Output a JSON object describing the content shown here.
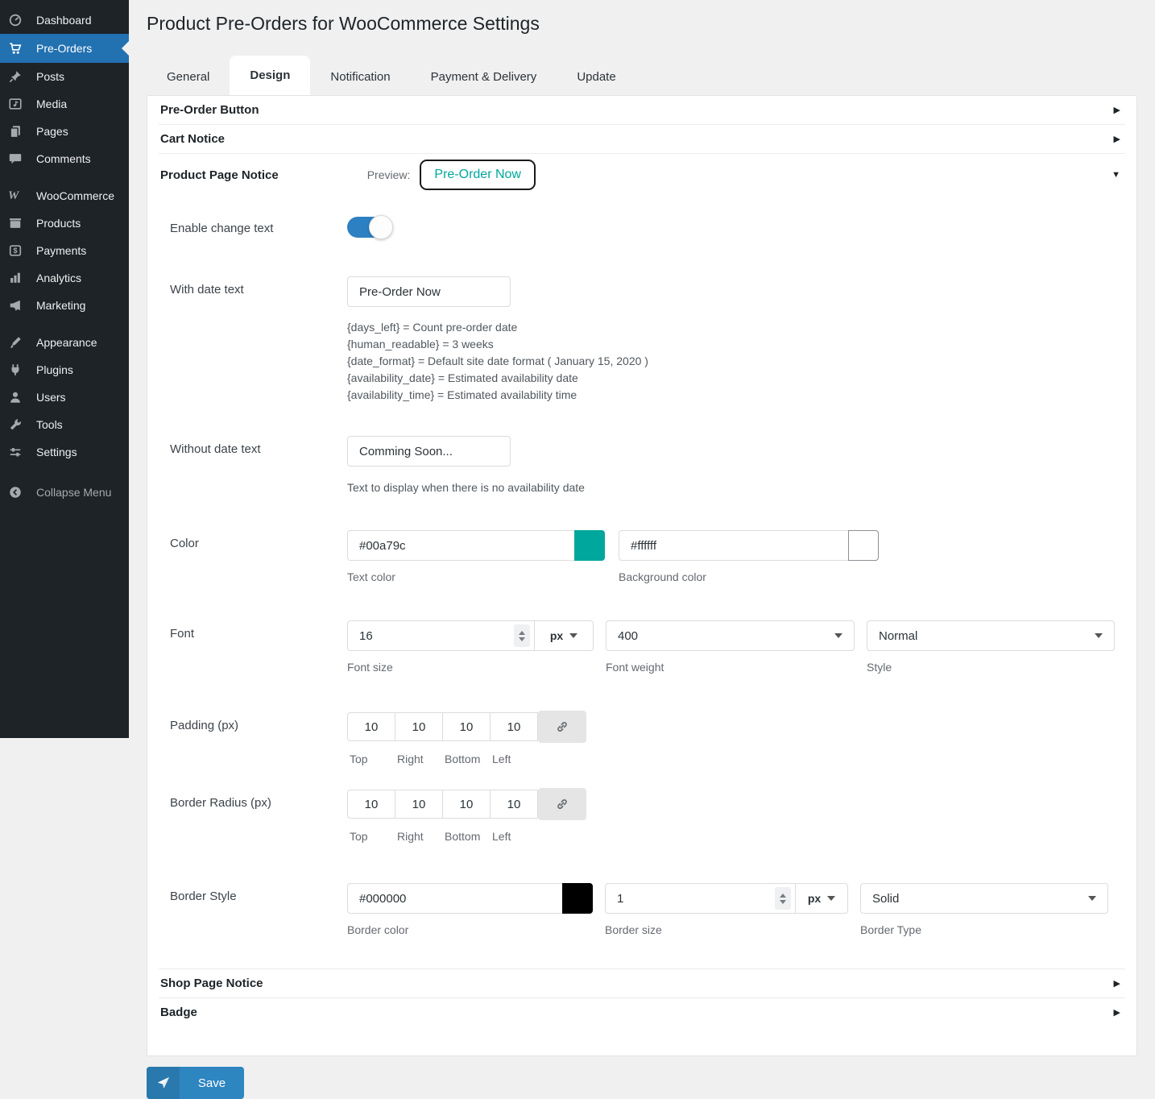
{
  "header": {
    "title": "Product Pre-Orders for WooCommerce Settings"
  },
  "sidebar": {
    "items": [
      {
        "label": "Dashboard",
        "icon": "dashboard-icon"
      },
      {
        "label": "Pre-Orders",
        "icon": "cart-icon",
        "active": true
      },
      {
        "label": "Posts",
        "icon": "pin-icon"
      },
      {
        "label": "Media",
        "icon": "media-icon"
      },
      {
        "label": "Pages",
        "icon": "pages-icon"
      },
      {
        "label": "Comments",
        "icon": "comment-icon"
      },
      {
        "label": "WooCommerce",
        "icon": "woocommerce-icon",
        "glyph": "W"
      },
      {
        "label": "Products",
        "icon": "box-icon"
      },
      {
        "label": "Payments",
        "icon": "payments-icon"
      },
      {
        "label": "Analytics",
        "icon": "bar-chart-icon"
      },
      {
        "label": "Marketing",
        "icon": "megaphone-icon"
      },
      {
        "label": "Appearance",
        "icon": "brush-icon"
      },
      {
        "label": "Plugins",
        "icon": "plug-icon"
      },
      {
        "label": "Users",
        "icon": "user-icon"
      },
      {
        "label": "Tools",
        "icon": "wrench-icon"
      },
      {
        "label": "Settings",
        "icon": "sliders-icon"
      },
      {
        "label": "Collapse Menu",
        "icon": "collapse-icon"
      }
    ]
  },
  "tabs": [
    {
      "label": "General"
    },
    {
      "label": "Design",
      "active": true
    },
    {
      "label": "Notification"
    },
    {
      "label": "Payment & Delivery"
    },
    {
      "label": "Update"
    }
  ],
  "icons": {
    "chevron_right": "▶",
    "chevron_down": "▼"
  },
  "sections": {
    "pre_order_button": "Pre-Order Button",
    "cart_notice": "Cart Notice",
    "product_page_notice": {
      "title": "Product Page Notice",
      "preview_label": "Preview:",
      "preview_text": "Pre-Order Now"
    },
    "shop_page_notice": "Shop Page Notice",
    "badge": "Badge"
  },
  "form": {
    "enable_change_text": {
      "label": "Enable change text",
      "enabled": true
    },
    "with_date_text": {
      "label": "With date text",
      "value": "Pre-Order Now",
      "help": [
        "{days_left} = Count pre-order date",
        "{human_readable} = 3 weeks",
        "{date_format} = Default site date format ( January 15, 2020 )",
        "{availability_date} = Estimated availability date",
        "{availability_time} = Estimated availability time"
      ]
    },
    "without_date_text": {
      "label": "Without date text",
      "value": "Comming Soon...",
      "help": "Text to display when there is no availability date"
    },
    "color": {
      "label": "Color",
      "text_color": {
        "value": "#00a79c",
        "caption": "Text color"
      },
      "background_color": {
        "value": "#ffffff",
        "caption": "Background color"
      }
    },
    "font": {
      "label": "Font",
      "size": {
        "value": "16",
        "unit": "px",
        "caption": "Font size"
      },
      "weight": {
        "value": "400",
        "caption": "Font weight"
      },
      "style": {
        "value": "Normal",
        "caption": "Style"
      }
    },
    "padding": {
      "label": "Padding (px)",
      "values": [
        "10",
        "10",
        "10",
        "10"
      ],
      "captions": [
        "Top",
        "Right",
        "Bottom",
        "Left"
      ]
    },
    "border_radius": {
      "label": "Border Radius (px)",
      "values": [
        "10",
        "10",
        "10",
        "10"
      ],
      "captions": [
        "Top",
        "Right",
        "Bottom",
        "Left"
      ]
    },
    "border_style": {
      "label": "Border Style",
      "color": {
        "value": "#000000",
        "caption": "Border color"
      },
      "size": {
        "value": "1",
        "unit": "px",
        "caption": "Border size"
      },
      "type": {
        "value": "Solid",
        "caption": "Border Type"
      }
    }
  },
  "save_button": {
    "label": "Save"
  },
  "colors": {
    "accent_teal": "#00a79c",
    "active_menu_blue": "#2271b1",
    "toggle_on_blue": "#2d80c2",
    "save_blue": "#2e86c1",
    "save_icon_blue": "#2a79ae",
    "preview_text": "#00a79c",
    "background_swatch": "#ffffff",
    "border_swatch": "#000000"
  }
}
